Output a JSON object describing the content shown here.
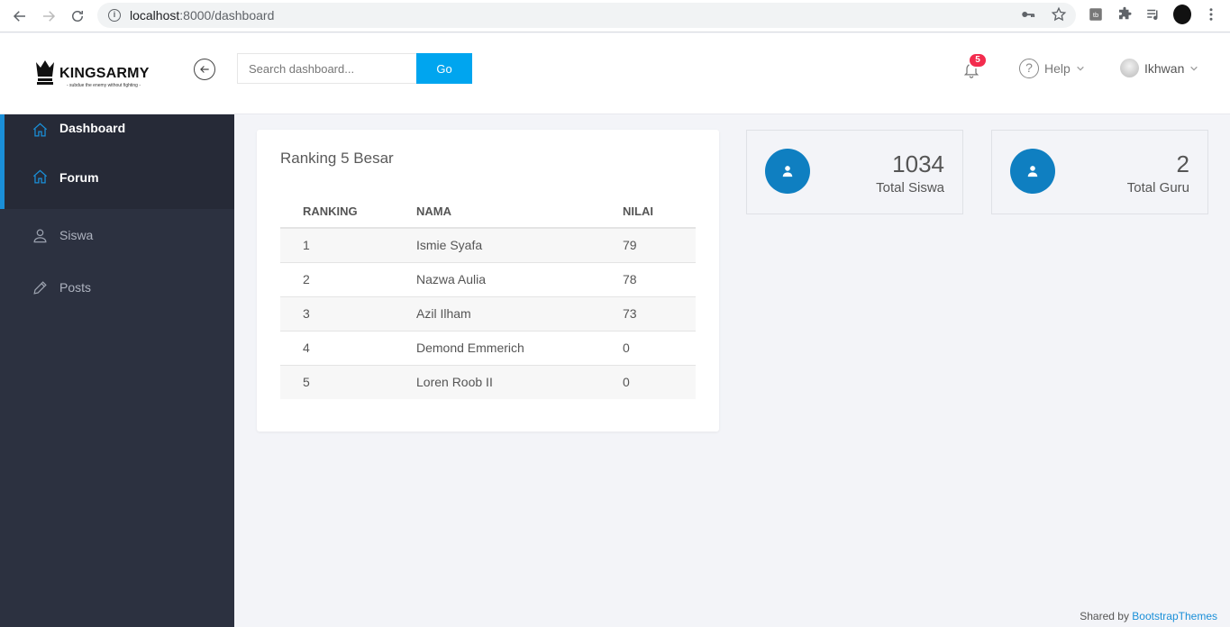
{
  "browser": {
    "url_host": "localhost",
    "url_path": ":8000/dashboard"
  },
  "header": {
    "logo_name": "KINGSARMY",
    "logo_tagline": "- subdue the enemy without fighting -",
    "search_placeholder": "Search dashboard...",
    "search_button": "Go",
    "notification_count": "5",
    "help_label": "Help",
    "user_name": "Ikhwan"
  },
  "sidebar": {
    "items": [
      {
        "label": "Dashboard",
        "icon": "home-icon",
        "active": true
      },
      {
        "label": "Forum",
        "icon": "home-icon",
        "active": true
      },
      {
        "label": "Siswa",
        "icon": "user-icon",
        "active": false
      },
      {
        "label": "Posts",
        "icon": "pencil-icon",
        "active": false
      }
    ]
  },
  "ranking": {
    "title": "Ranking 5 Besar",
    "columns": [
      "RANKING",
      "NAMA",
      "NILAI"
    ],
    "rows": [
      [
        "1",
        "Ismie Syafa",
        "79"
      ],
      [
        "2",
        "Nazwa Aulia",
        "78"
      ],
      [
        "3",
        "Azil Ilham",
        "73"
      ],
      [
        "4",
        "Demond Emmerich",
        "0"
      ],
      [
        "5",
        "Loren Roob II",
        "0"
      ]
    ]
  },
  "stats": [
    {
      "value": "1034",
      "label": "Total Siswa"
    },
    {
      "value": "2",
      "label": "Total Guru"
    }
  ],
  "footer": {
    "prefix": "Shared by",
    "link": "BootstrapThemes"
  },
  "colors": {
    "accent": "#00a5ef",
    "sidebar_bg": "#2c3140",
    "stat_circle": "#0f7fc1",
    "badge": "#f32c4e"
  }
}
